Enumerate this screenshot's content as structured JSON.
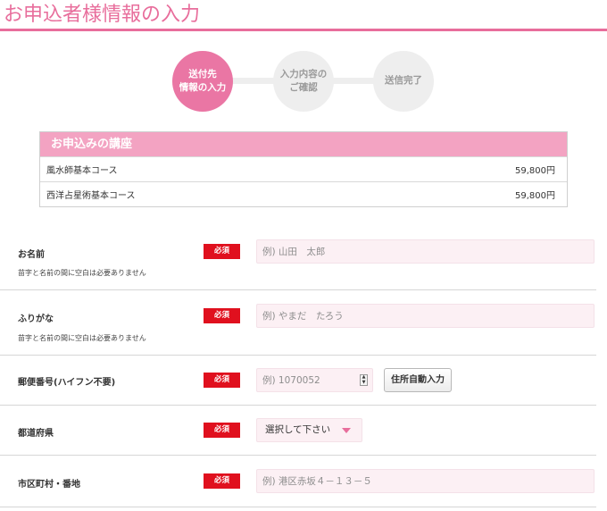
{
  "page": {
    "title": "お申込者様情報の入力"
  },
  "steps": [
    {
      "label": "送付先\n情報の入力",
      "active": true
    },
    {
      "label": "入力内容の\nご確認",
      "active": false
    },
    {
      "label": "送信完了",
      "active": false
    }
  ],
  "courses": {
    "heading": "お申込みの講座",
    "items": [
      {
        "name": "風水師基本コース",
        "price": "59,800円"
      },
      {
        "name": "西洋占星術基本コース",
        "price": "59,800円"
      }
    ]
  },
  "form": {
    "required_label": "必須",
    "name": {
      "label": "お名前",
      "note": "苗字と名前の間に空白は必要ありません",
      "placeholder": "例) 山田　太郎"
    },
    "kana": {
      "label": "ふりがな",
      "note": "苗字と名前の間に空白は必要ありません",
      "placeholder": "例) やまだ　たろう"
    },
    "postal": {
      "label": "郵便番号(ハイフン不要)",
      "placeholder": "例) 1070052",
      "auto_button": "住所自動入力"
    },
    "prefecture": {
      "label": "都道府県",
      "selected": "選択して下さい"
    },
    "city": {
      "label": "市区町村・番地",
      "placeholder": "例) 港区赤坂４－１３－５"
    }
  },
  "colors": {
    "accent": "#e86e9c",
    "required": "#e0101e",
    "input_bg": "#fcf0f4",
    "course_header": "#f3a3c2"
  }
}
